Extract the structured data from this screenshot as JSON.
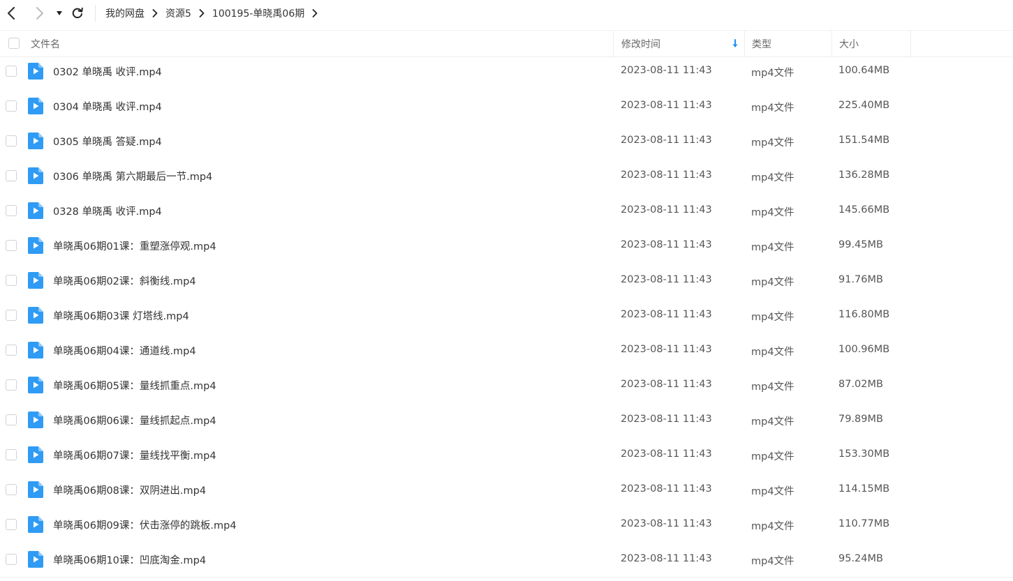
{
  "nav": {
    "back_icon": "chevron-left-icon",
    "forward_icon": "chevron-right-icon",
    "history_icon": "dropdown-triangle-icon",
    "refresh_icon": "refresh-icon"
  },
  "breadcrumb": {
    "items": [
      {
        "label": "我的网盘"
      },
      {
        "label": "资源5"
      },
      {
        "label": "100195-单晓禹06期"
      }
    ]
  },
  "table": {
    "columns": {
      "name": "文件名",
      "modified": "修改时间",
      "type": "类型",
      "size": "大小"
    },
    "sort": {
      "column": "modified",
      "icon": "sort-down-arrow-icon"
    },
    "rows": [
      {
        "name": "0302 单晓禹 收评.mp4",
        "modified": "2023-08-11 11:43",
        "type": "mp4文件",
        "size": "100.64MB"
      },
      {
        "name": "0304 单晓禹 收评.mp4",
        "modified": "2023-08-11 11:43",
        "type": "mp4文件",
        "size": "225.40MB"
      },
      {
        "name": "0305 单晓禹 答疑.mp4",
        "modified": "2023-08-11 11:43",
        "type": "mp4文件",
        "size": "151.54MB"
      },
      {
        "name": "0306 单晓禹 第六期最后一节.mp4",
        "modified": "2023-08-11 11:43",
        "type": "mp4文件",
        "size": "136.28MB"
      },
      {
        "name": "0328 单晓禹 收评.mp4",
        "modified": "2023-08-11 11:43",
        "type": "mp4文件",
        "size": "145.66MB"
      },
      {
        "name": "单晓禹06期01课：重塑涨停观.mp4",
        "modified": "2023-08-11 11:43",
        "type": "mp4文件",
        "size": "99.45MB"
      },
      {
        "name": "单晓禹06期02课：斜衡线.mp4",
        "modified": "2023-08-11 11:43",
        "type": "mp4文件",
        "size": "91.76MB"
      },
      {
        "name": "单晓禹06期03课 灯塔线.mp4",
        "modified": "2023-08-11 11:43",
        "type": "mp4文件",
        "size": "116.80MB"
      },
      {
        "name": "单晓禹06期04课：通道线.mp4",
        "modified": "2023-08-11 11:43",
        "type": "mp4文件",
        "size": "100.96MB"
      },
      {
        "name": "单晓禹06期05课：量线抓重点.mp4",
        "modified": "2023-08-11 11:43",
        "type": "mp4文件",
        "size": "87.02MB"
      },
      {
        "name": "单晓禹06期06课：量线抓起点.mp4",
        "modified": "2023-08-11 11:43",
        "type": "mp4文件",
        "size": "79.89MB"
      },
      {
        "name": "单晓禹06期07课：量线找平衡.mp4",
        "modified": "2023-08-11 11:43",
        "type": "mp4文件",
        "size": "153.30MB"
      },
      {
        "name": "单晓禹06期08课：双阴进出.mp4",
        "modified": "2023-08-11 11:43",
        "type": "mp4文件",
        "size": "114.15MB"
      },
      {
        "name": "单晓禹06期09课：伏击涨停的跳板.mp4",
        "modified": "2023-08-11 11:43",
        "type": "mp4文件",
        "size": "110.77MB"
      },
      {
        "name": "单晓禹06期10课：凹底淘金.mp4",
        "modified": "2023-08-11 11:43",
        "type": "mp4文件",
        "size": "95.24MB"
      }
    ]
  },
  "colors": {
    "video_icon": "#2f9bf5",
    "sort_arrow": "#1e8ff0"
  },
  "file_icon": "video-file-icon"
}
